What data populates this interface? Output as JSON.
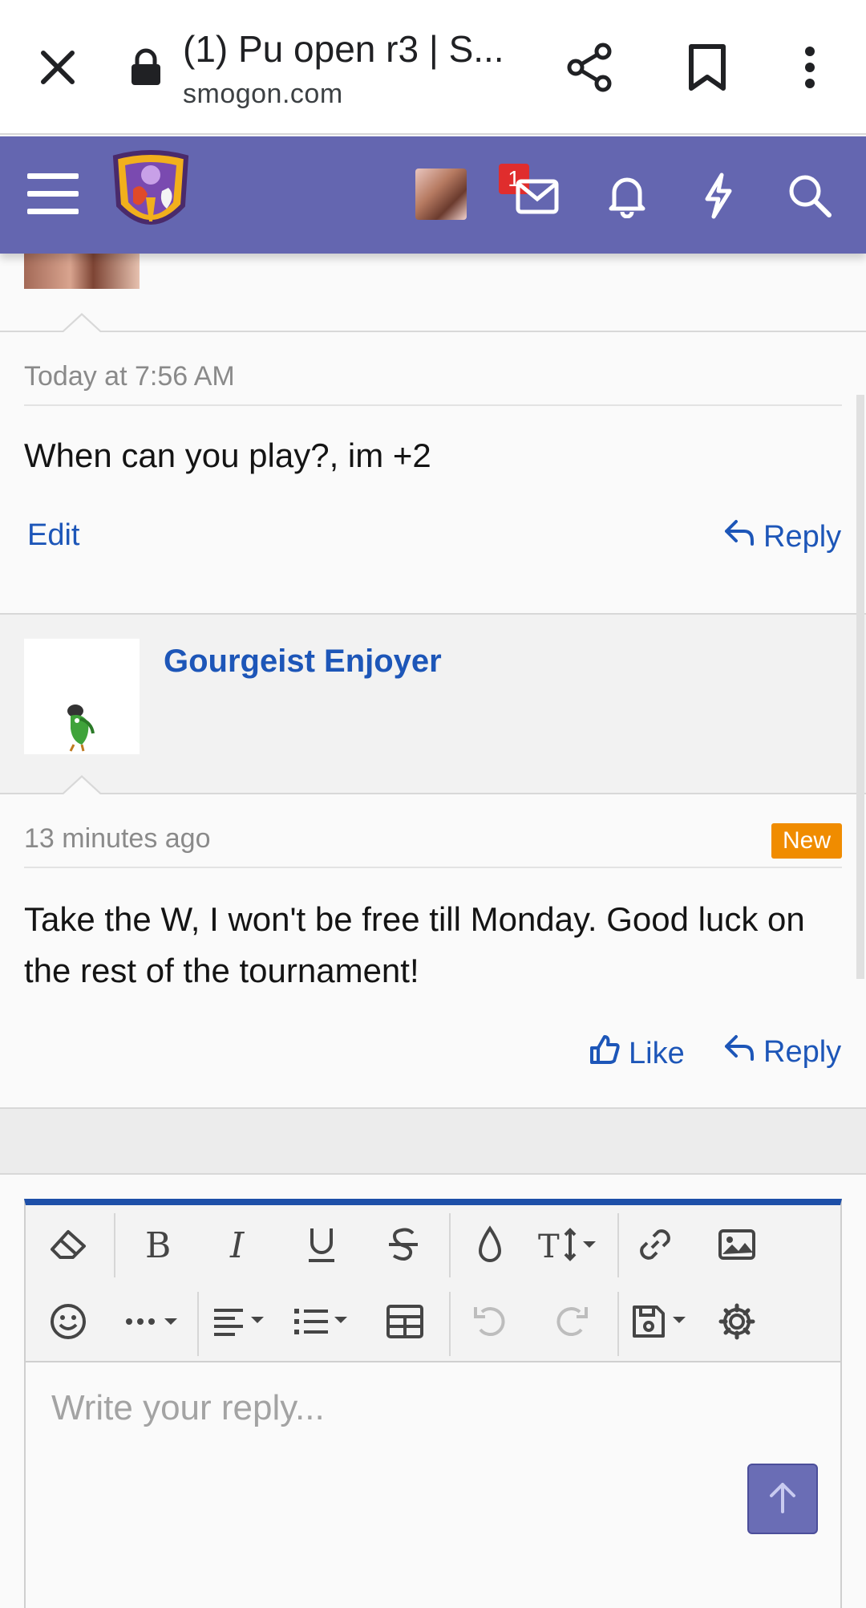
{
  "browser": {
    "tab_title": "(1) Pu open r3 | S...",
    "domain": "smogon.com"
  },
  "header": {
    "inbox_badge": "1"
  },
  "posts": [
    {
      "time": "Today at 7:56 AM",
      "body": "When can you play?, im +2",
      "actions": {
        "edit": "Edit",
        "reply": "Reply"
      }
    },
    {
      "author": "Gourgeist Enjoyer",
      "time": "13 minutes ago",
      "badge": "New",
      "body": "Take the W, I won't be free till Monday. Good luck on the rest of the tournament!",
      "actions": {
        "like": "Like",
        "reply": "Reply"
      }
    }
  ],
  "editor": {
    "placeholder": "Write your reply..."
  },
  "colors": {
    "header_bg": "#6466b0",
    "link": "#1d56b8",
    "badge_new": "#f08c00",
    "badge_alert": "#e02d2d",
    "editor_accent": "#1d4fa8"
  },
  "icons": [
    "close-icon",
    "lock-icon",
    "share-icon",
    "bookmark-icon",
    "more-vert-icon",
    "hamburger-icon",
    "site-logo",
    "inbox-icon",
    "bell-icon",
    "bolt-icon",
    "search-icon",
    "reply-icon",
    "like-icon",
    "eraser-icon",
    "bold-icon",
    "italic-icon",
    "underline-icon",
    "strikethrough-icon",
    "color-drop-icon",
    "font-size-icon",
    "link-icon",
    "image-icon",
    "emoji-icon",
    "more-options-icon",
    "align-icon",
    "list-icon",
    "table-icon",
    "undo-icon",
    "redo-icon",
    "save-draft-icon",
    "settings-icon",
    "arrow-up-icon"
  ]
}
